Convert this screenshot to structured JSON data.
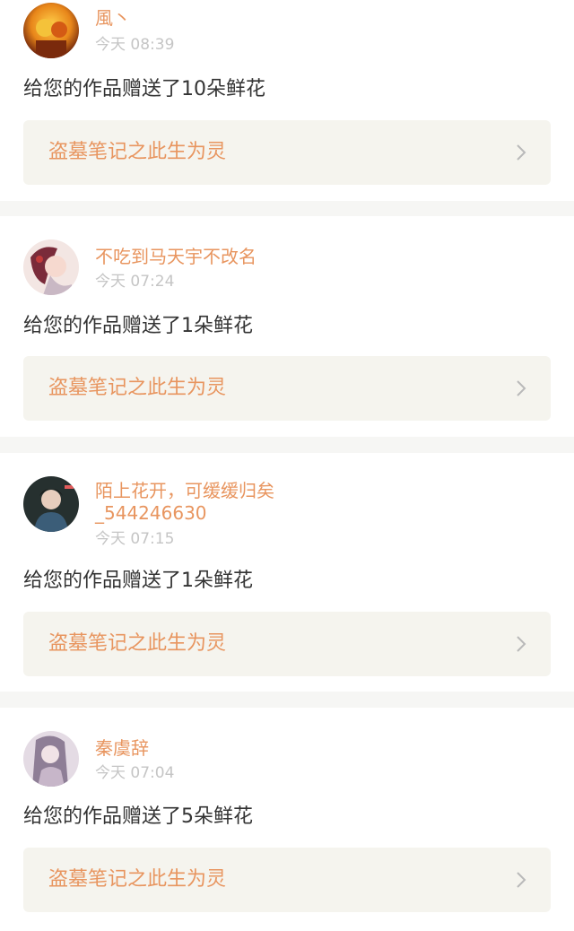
{
  "notifications": [
    {
      "username_lines": [
        "風丶"
      ],
      "time": "今天 08:39",
      "message": "给您的作品赠送了10朵鲜花",
      "work_title": "盗墓笔记之此生为灵",
      "avatar_colors": [
        "#f2a51a",
        "#8b2e0e"
      ]
    },
    {
      "username_lines": [
        "不吃到马天宇不改名"
      ],
      "time": "今天 07:24",
      "message": "给您的作品赠送了1朵鲜花",
      "work_title": "盗墓笔记之此生为灵",
      "avatar_colors": [
        "#f3e4e0",
        "#b43a3a"
      ]
    },
    {
      "username_lines": [
        "陌上花开，可缓缓归矣",
        "_544246630"
      ],
      "time": "今天 07:15",
      "message": "给您的作品赠送了1朵鲜花",
      "work_title": "盗墓笔记之此生为灵",
      "avatar_colors": [
        "#2d3b3a",
        "#c9d6d0"
      ]
    },
    {
      "username_lines": [
        "秦虞辞"
      ],
      "time": "今天 07:04",
      "message": "给您的作品赠送了5朵鲜花",
      "work_title": "盗墓笔记之此生为灵",
      "avatar_colors": [
        "#d9cbd8",
        "#8a7a92"
      ]
    }
  ],
  "theme": {
    "accent": "#e8955f",
    "text": "#333333",
    "muted": "#c5c5c5",
    "link_bg": "#f5f4ee",
    "page_bg": "#f6f6f4"
  }
}
